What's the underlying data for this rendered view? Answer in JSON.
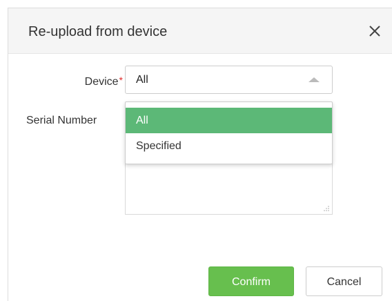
{
  "dialog": {
    "title": "Re-upload from device",
    "close_icon": "close-icon"
  },
  "form": {
    "device_label": "Device",
    "required_mark": "*",
    "device_value": "All",
    "serial_label": "Serial Number",
    "serial_value": ""
  },
  "dropdown": {
    "options": [
      {
        "label": "All",
        "selected": true
      },
      {
        "label": "Specified",
        "selected": false
      }
    ]
  },
  "buttons": {
    "confirm_label": "Confirm",
    "cancel_label": "Cancel"
  },
  "colors": {
    "selected_option": "#5cb877",
    "confirm_button": "#67bf4e",
    "required_mark": "#e02b2b"
  }
}
